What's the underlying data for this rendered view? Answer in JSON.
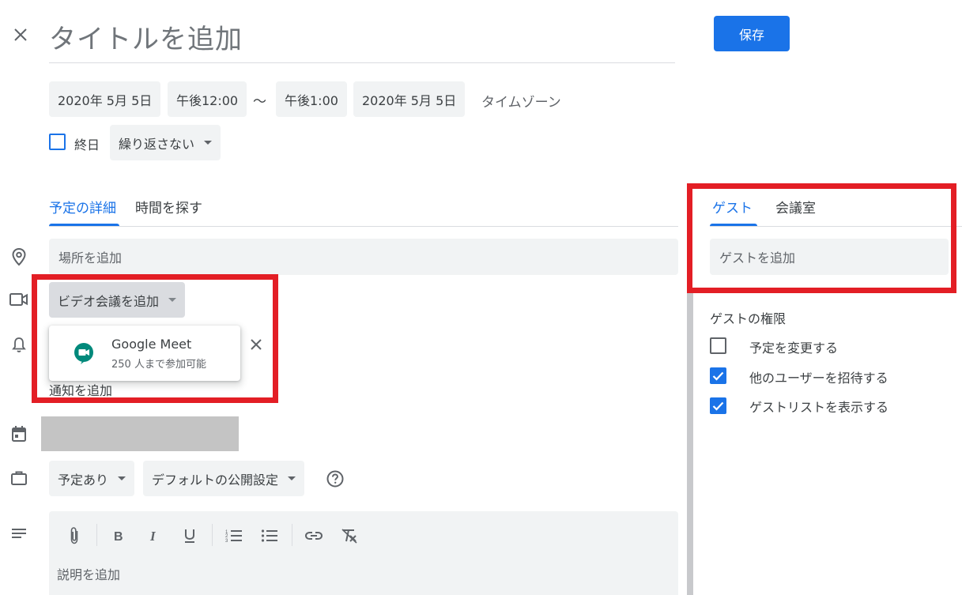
{
  "header": {
    "title_placeholder": "タイトルを追加",
    "save_label": "保存"
  },
  "datetime": {
    "start_date": "2020年 5月 5日",
    "start_time": "午後12:00",
    "separator": "〜",
    "end_time": "午後1:00",
    "end_date": "2020年 5月 5日",
    "timezone_label": "タイムゾーン",
    "all_day_label": "終日",
    "all_day_checked": false,
    "repeat_label": "繰り返さない"
  },
  "tabs": {
    "details": "予定の詳細",
    "find_time": "時間を探す",
    "guests": "ゲスト",
    "rooms": "会議室"
  },
  "details": {
    "location_placeholder": "場所を追加",
    "video_label": "ビデオ会議を追加",
    "notification_label": "通知を追加",
    "availability_label": "予定あり",
    "visibility_label": "デフォルトの公開設定",
    "description_placeholder": "説明を追加"
  },
  "meet_popup": {
    "title": "Google Meet",
    "subtitle": "250 人まで参加可能"
  },
  "guests": {
    "add_placeholder": "ゲストを追加",
    "permissions_title": "ゲストの権限",
    "permissions": [
      {
        "label": "予定を変更する",
        "checked": false
      },
      {
        "label": "他のユーザーを招待する",
        "checked": true
      },
      {
        "label": "ゲストリストを表示する",
        "checked": true
      }
    ]
  },
  "colors": {
    "accent": "#1a73e8",
    "highlight": "#e31e25",
    "field_bg": "#f1f3f4",
    "meet_green": "#00897b"
  }
}
